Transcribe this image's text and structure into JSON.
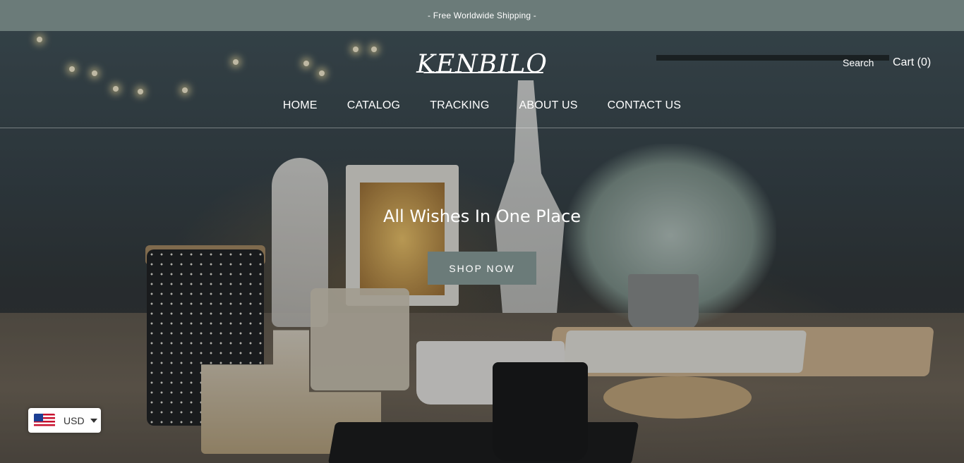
{
  "announcement": {
    "text": "- Free Worldwide Shipping -"
  },
  "header": {
    "logo_text": "KENBILO",
    "search_label": "Search",
    "cart_label": "Cart (0)"
  },
  "nav": {
    "items": [
      {
        "label": "HOME"
      },
      {
        "label": "CATALOG"
      },
      {
        "label": "TRACKING"
      },
      {
        "label": "ABOUT US"
      },
      {
        "label": "CONTACT US"
      }
    ]
  },
  "hero": {
    "title": "All Wishes In One Place",
    "button_label": "SHOP NOW"
  },
  "currency": {
    "flag_icon": "us-flag-icon",
    "code": "USD"
  },
  "colors": {
    "announcement_bg": "#6b7b79",
    "button_bg": "#6b7b79",
    "text": "#ffffff"
  }
}
